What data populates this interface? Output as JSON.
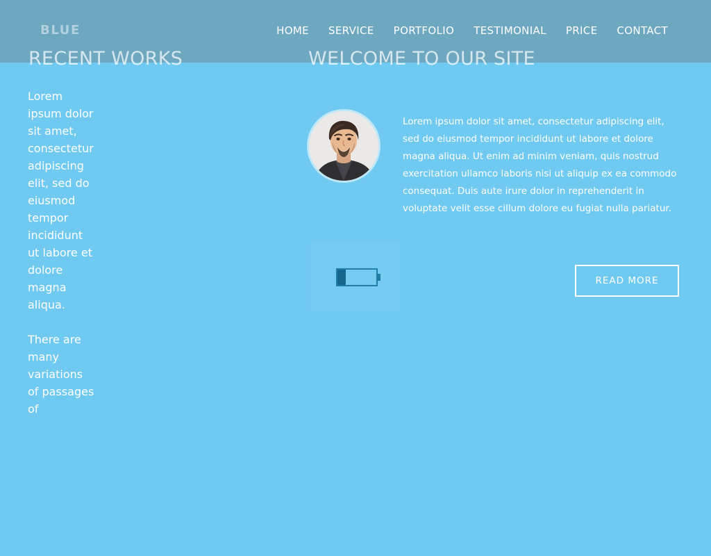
{
  "site": {
    "logo": "BLUE",
    "background_color": "#6fc9f0",
    "header_color": "#6da7c0",
    "accent_text_color": "#ffffff"
  },
  "nav": {
    "items": [
      {
        "label": "HOME"
      },
      {
        "label": "SERVICE"
      },
      {
        "label": "PORTFOLIO"
      },
      {
        "label": "TESTIMONIAL"
      },
      {
        "label": "PRICE"
      },
      {
        "label": "CONTACT"
      }
    ]
  },
  "headings": {
    "recent_works": "RECENT WORKS",
    "welcome": "WELCOME TO OUR SITE"
  },
  "left_column": {
    "paragraph_1": "Lorem ipsum dolor sit amet, consectetur adipiscing elit, sed do eiusmod tempor incididunt ut labore et dolore magna aliqua.",
    "paragraph_2": "There are many variations of passages of"
  },
  "main": {
    "avatar_alt": "profile-photo",
    "intro_paragraph": "Lorem ipsum dolor sit amet, consectetur adipiscing elit, sed do eiusmod tempor incididunt ut labore et dolore magna aliqua. Ut enim ad minim veniam, quis nostrud exercitation ullamco laboris nisi ut aliquip ex ea commodo consequat. Duis aute irure dolor in reprehenderit in voluptate velit esse cillum dolore eu fugiat nulla pariatur.",
    "read_more_label": "READ MORE",
    "battery": {
      "icon_name": "battery-low-icon",
      "fill_percent": 20,
      "outline_color": "#1f7ea8",
      "fill_color": "#15678c"
    }
  }
}
